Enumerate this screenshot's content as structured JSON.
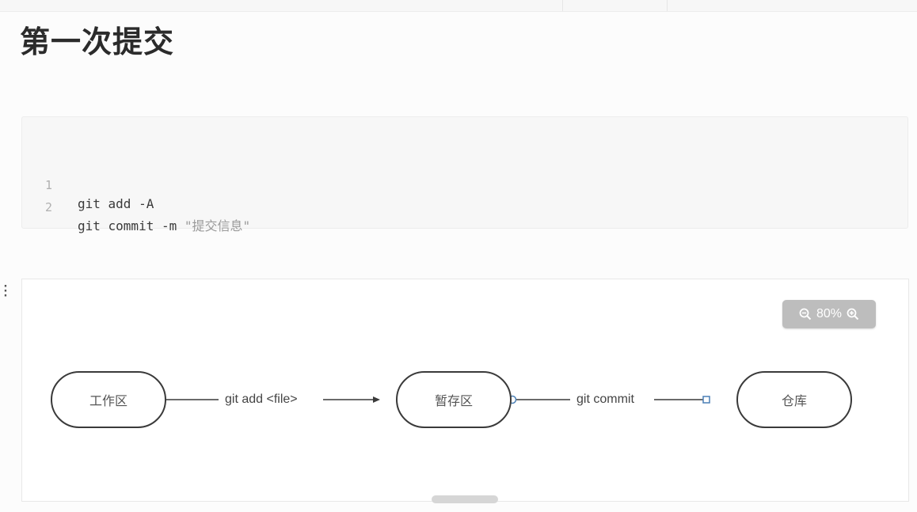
{
  "page": {
    "title": "第一次提交"
  },
  "code": {
    "lines": [
      {
        "num": "1",
        "text": "git add -A"
      },
      {
        "num": "2",
        "command": "git commit -m ",
        "string": "\"提交信息\""
      }
    ]
  },
  "diagram": {
    "zoom": {
      "value": "80%",
      "zoom_out_icon": "zoom-out-icon",
      "zoom_in_icon": "zoom-in-icon"
    },
    "nodes": {
      "working": "工作区",
      "staging": "暂存区",
      "repo": "仓库"
    },
    "edges": {
      "add": "git add <file>",
      "commit": "git commit"
    },
    "colors": {
      "node_border": "#3a3a3a",
      "connector": "#4a7fb5",
      "zoom_bg": "#bdbdbd"
    }
  }
}
